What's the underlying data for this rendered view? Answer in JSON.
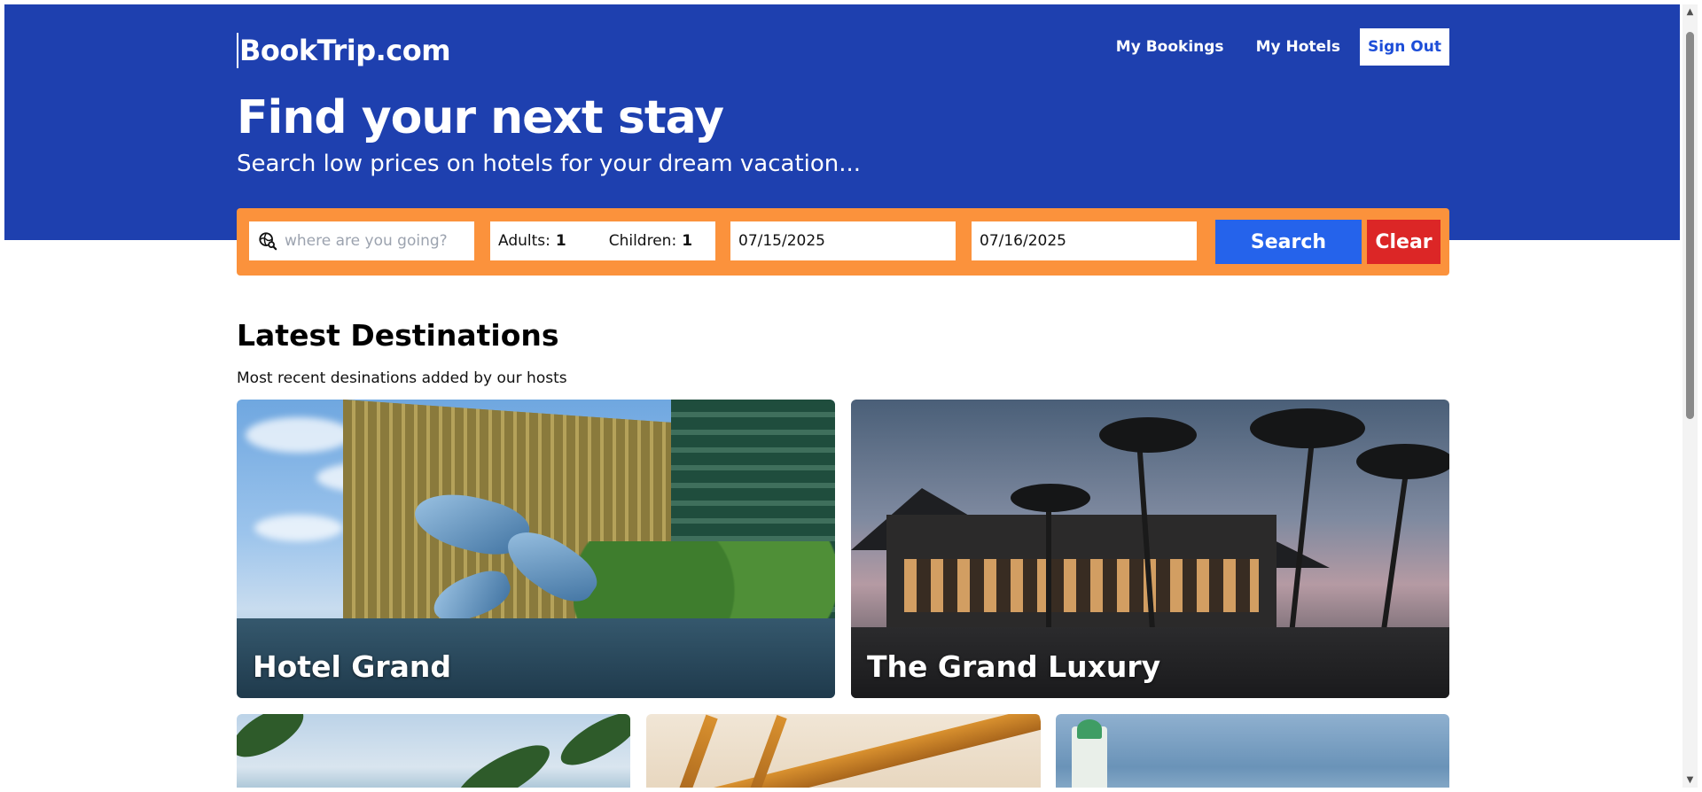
{
  "header": {
    "logo": "BookTrip.com",
    "nav": {
      "my_bookings": "My Bookings",
      "my_hotels": "My Hotels",
      "sign_out": "Sign Out"
    },
    "hero_title": "Find your next stay",
    "hero_subtitle": "Search low prices on hotels for your dream vacation..."
  },
  "search": {
    "destination_placeholder": "where are you going?",
    "destination_value": "",
    "adults_label": "Adults:",
    "adults_value": "1",
    "children_label": "Children:",
    "children_value": "1",
    "check_in": "07/15/2025",
    "check_out": "07/16/2025",
    "search_label": "Search",
    "clear_label": "Clear"
  },
  "latest": {
    "title": "Latest Destinations",
    "subtitle": "Most recent desinations added by our hosts",
    "cards": [
      {
        "name": "Hotel Grand"
      },
      {
        "name": "The Grand Luxury"
      },
      {
        "name": ""
      },
      {
        "name": ""
      },
      {
        "name": ""
      }
    ]
  },
  "colors": {
    "brand": "#1e40af",
    "search_bar": "#fb923c",
    "search_button": "#2563eb",
    "clear_button": "#dc2626"
  },
  "icons": {
    "destination": "globe-search-icon",
    "scroll_up": "chevron-up-icon",
    "scroll_down": "chevron-down-icon"
  }
}
